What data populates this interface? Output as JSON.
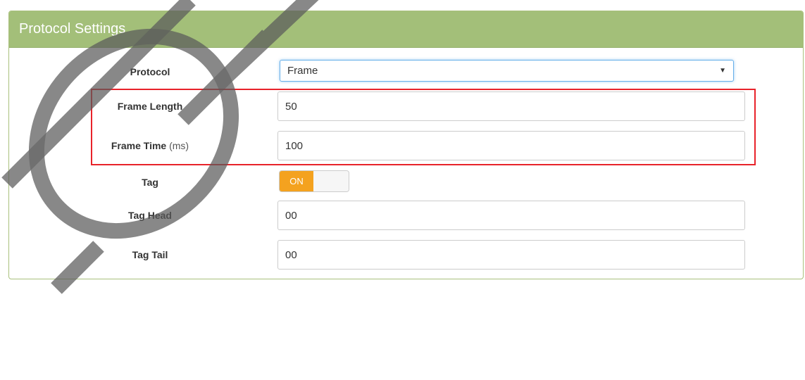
{
  "panel": {
    "title": "Protocol Settings"
  },
  "fields": {
    "protocol": {
      "label": "Protocol",
      "value": "Frame",
      "caret": "▼"
    },
    "frame_length": {
      "label": "Frame Length",
      "value": "50"
    },
    "frame_time": {
      "label": "Frame Time",
      "unit": "(ms)",
      "value": "100"
    },
    "tag": {
      "label": "Tag",
      "toggle_label": "ON"
    },
    "tag_head": {
      "label": "Tag Head",
      "value": "00"
    },
    "tag_tail": {
      "label": "Tag Tail",
      "value": "00"
    }
  },
  "colors": {
    "header_bg": "#a3bf79",
    "toggle_on": "#f4a21f",
    "highlight_border": "#e8232a",
    "watermark": "#555555"
  }
}
